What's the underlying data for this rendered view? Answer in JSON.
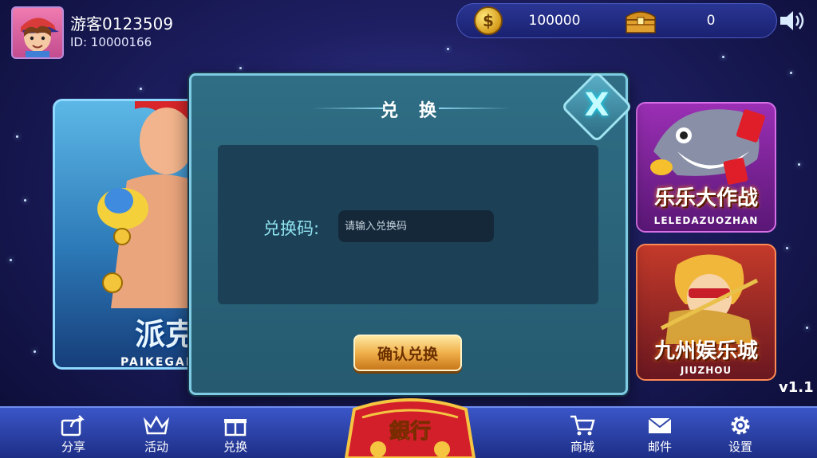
{
  "user": {
    "name": "游客0123509",
    "id_text": "ID: 10000166"
  },
  "currency": {
    "coins": "100000",
    "bank": "0"
  },
  "games": {
    "left": {
      "title": "派克",
      "subtitle": "PAIKEGAI"
    },
    "right_top": {
      "title": "乐乐大作战",
      "subtitle": "LELEDAZUOZHAN"
    },
    "right_bottom": {
      "title": "九州娱乐城",
      "subtitle": "JIUZHOU"
    }
  },
  "version": "v1.1",
  "modal": {
    "title": "兑换",
    "close_label": "X",
    "code_label": "兑换码:",
    "code_placeholder": "请输入兑换码",
    "confirm_label": "确认兑换"
  },
  "bottom_nav": {
    "share": "分享",
    "activity": "活动",
    "exchange": "兑换",
    "bank": "銀行",
    "shop": "商城",
    "mail": "邮件",
    "settings": "设置"
  },
  "icons": {
    "coin": "coin-icon",
    "chest": "treasure-chest-icon",
    "sound": "speaker-icon",
    "share": "share-icon",
    "activity": "crown-icon",
    "exchange": "gift-icon",
    "shop": "cart-icon",
    "mail": "envelope-icon",
    "settings": "gear-icon"
  },
  "colors": {
    "modal_bg": "#2f6e85",
    "accent_gold": "#f0b04a",
    "label_cyan": "#8fe3f0",
    "bar_blue": "#3a56c8"
  }
}
